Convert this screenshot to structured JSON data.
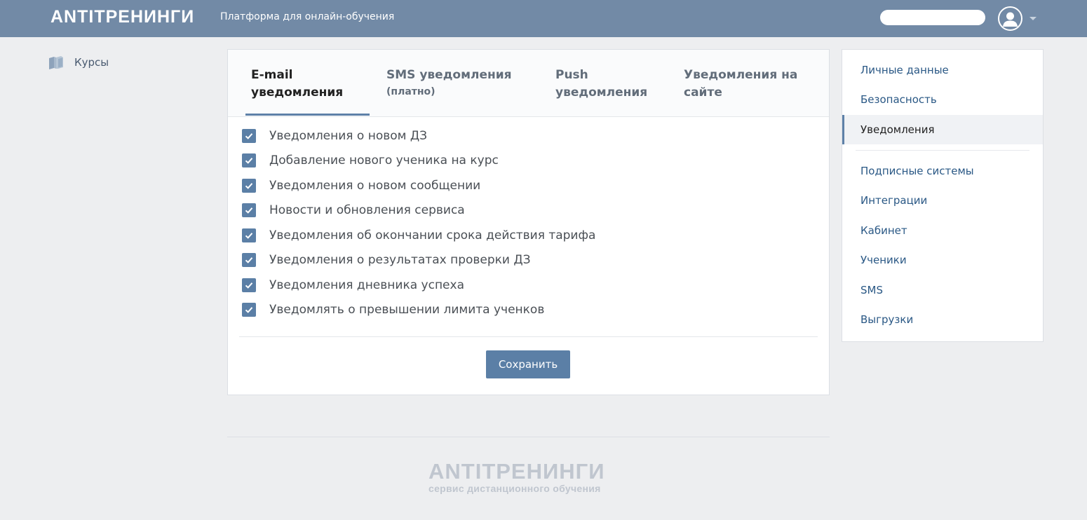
{
  "header": {
    "logo": "ANTITРЕНИНГИ",
    "tagline": "Платформа для онлайн-обучения"
  },
  "left_nav": {
    "items": [
      {
        "label": "Курсы",
        "icon": "books-icon"
      }
    ]
  },
  "tabs": [
    {
      "line1": "E-mail",
      "line2": "уведомления",
      "active": true
    },
    {
      "line1": "SMS уведомления",
      "sub": "(платно)",
      "active": false
    },
    {
      "line1": "Push",
      "line2": "уведомления",
      "active": false
    },
    {
      "line1": "Уведомления на",
      "line2": "сайте",
      "active": false
    }
  ],
  "options": [
    {
      "label": "Уведомления о новом ДЗ",
      "checked": true
    },
    {
      "label": "Добавление нового ученика на курс",
      "checked": true
    },
    {
      "label": "Уведомления о новом сообщении",
      "checked": true
    },
    {
      "label": "Новости и обновления сервиса",
      "checked": true
    },
    {
      "label": "Уведомления об окончании срока действия тарифа",
      "checked": true
    },
    {
      "label": "Уведомления о результатах проверки ДЗ",
      "checked": true
    },
    {
      "label": "Уведомления дневника успеха",
      "checked": true
    },
    {
      "label": "Уведомлять о превышении лимита ученков",
      "checked": true
    }
  ],
  "save_label": "Сохранить",
  "right_menu": {
    "items": [
      {
        "label": "Личные данные",
        "active": false
      },
      {
        "label": "Безопасность",
        "active": false
      },
      {
        "label": "Уведомления",
        "active": true
      },
      {
        "label": "Подписные системы",
        "active": false
      },
      {
        "label": "Интеграции",
        "active": false
      },
      {
        "label": "Кабинет",
        "active": false
      },
      {
        "label": "Ученики",
        "active": false
      },
      {
        "label": "SMS",
        "active": false
      },
      {
        "label": "Выгрузки",
        "active": false
      }
    ]
  },
  "footer": {
    "logo": "ANTITРЕНИНГИ",
    "tagline": "сервис дистанционного обучения"
  },
  "colors": {
    "header_bg": "#728aa6",
    "accent": "#5b7fa6",
    "page_bg": "#edeef0"
  }
}
